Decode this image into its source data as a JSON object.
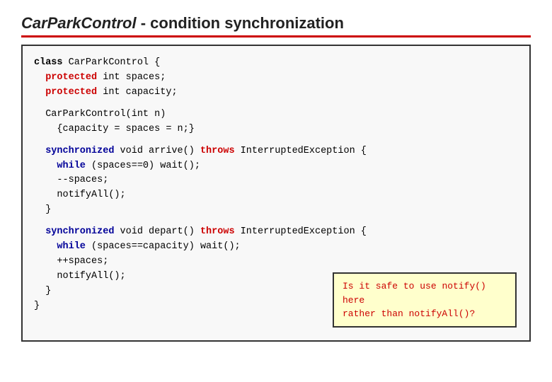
{
  "header": {
    "title_italic": "CarParkControl",
    "title_rest": " - condition synchronization"
  },
  "code": {
    "lines": [
      {
        "id": "l1",
        "text": "class CarParkControl {"
      },
      {
        "id": "l2",
        "text": "  protected int spaces;"
      },
      {
        "id": "l3",
        "text": "  protected int capacity;"
      },
      {
        "id": "l4",
        "text": ""
      },
      {
        "id": "l5",
        "text": "  CarParkControl(int n)"
      },
      {
        "id": "l6",
        "text": "    {capacity = spaces = n;}"
      },
      {
        "id": "l7",
        "text": ""
      },
      {
        "id": "l8",
        "text": "  synchronized void arrive() throws InterruptedException {"
      },
      {
        "id": "l9",
        "text": "    while (spaces==0) wait();"
      },
      {
        "id": "l10",
        "text": "    --spaces;"
      },
      {
        "id": "l11",
        "text": "    notifyAll();"
      },
      {
        "id": "l12",
        "text": "  }"
      },
      {
        "id": "l13",
        "text": ""
      },
      {
        "id": "l14",
        "text": "  synchronized void depart() throws InterruptedException {"
      },
      {
        "id": "l15",
        "text": "    while (spaces==capacity) wait();"
      },
      {
        "id": "l16",
        "text": "    ++spaces;"
      },
      {
        "id": "l17",
        "text": "    notifyAll();"
      },
      {
        "id": "l18",
        "text": "  }"
      },
      {
        "id": "l19",
        "text": "}"
      }
    ]
  },
  "tooltip": {
    "line1": "Is it safe to use ",
    "code1": "notify()",
    "line1b": "  here",
    "line2": "rather than ",
    "code2": "notifyAll()",
    "line2b": "?"
  }
}
